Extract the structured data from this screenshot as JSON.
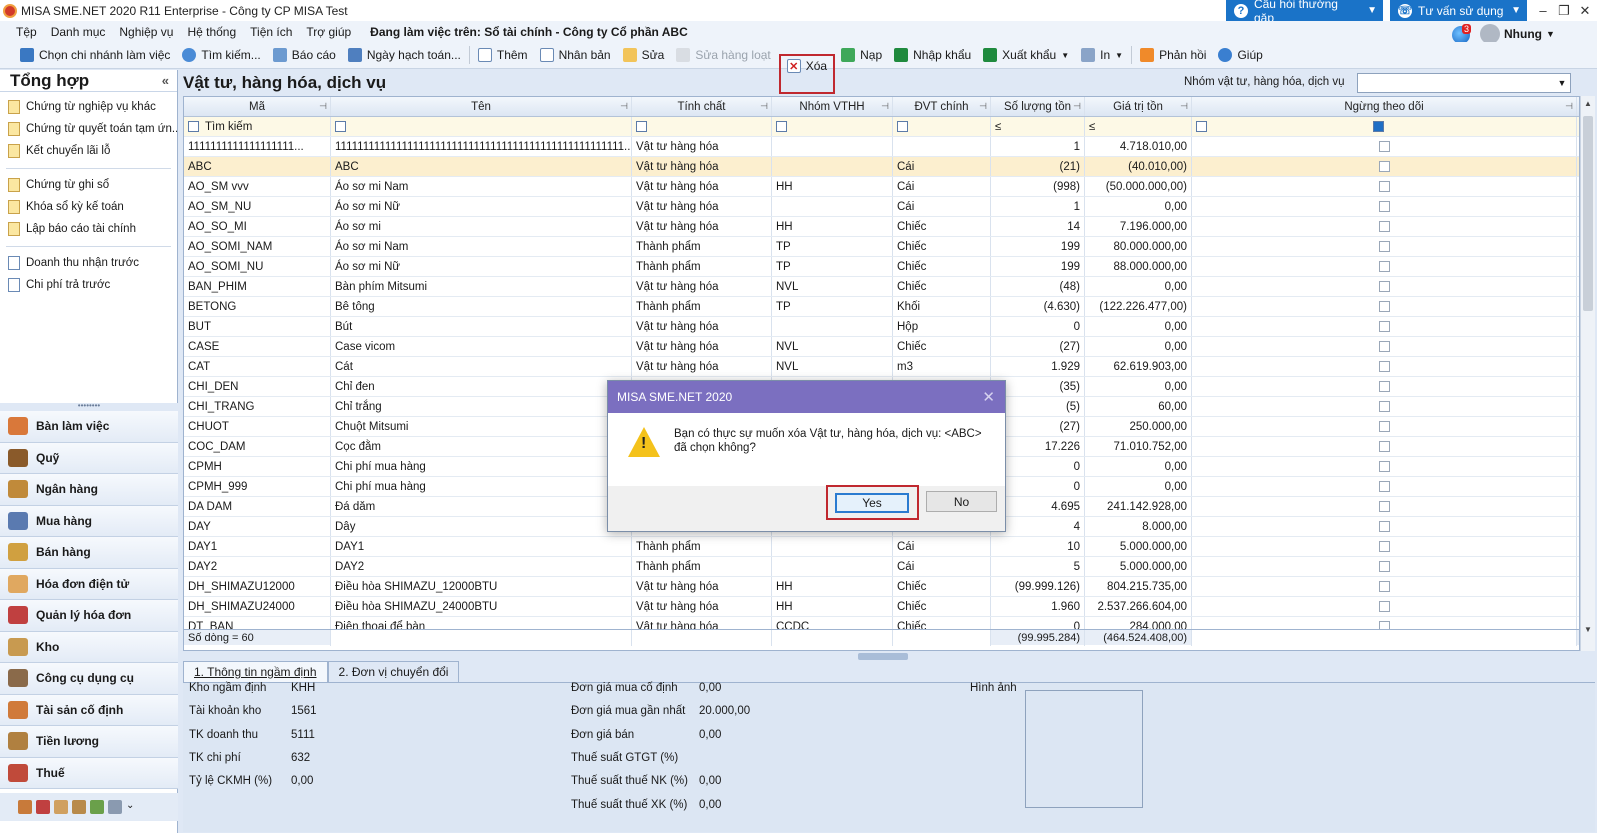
{
  "window": {
    "title": "MISA SME.NET 2020 R11 Enterprise - Công ty CP MISA Test",
    "help": "Câu hỏi thường gặp",
    "consult": "Tư vấn sử dụng"
  },
  "menu": {
    "items": [
      "Tệp",
      "Danh mục",
      "Nghiệp vụ",
      "Hệ thống",
      "Tiện ích",
      "Trợ giúp"
    ],
    "working": "Đang làm việc trên: Sổ tài chính - Công ty Cổ phần ABC"
  },
  "user": {
    "name": "Nhung",
    "notif_count": "3"
  },
  "toolbar": {
    "branch": "Chọn chi nhánh làm việc",
    "search": "Tìm kiếm...",
    "report": "Báo cáo",
    "date": "Ngày hạch toán...",
    "add": "Thêm",
    "copy": "Nhân bản",
    "edit": "Sửa",
    "bulk_edit": "Sửa hàng loạt",
    "delete": "Xóa",
    "load": "Nạp",
    "import": "Nhập khẩu",
    "export": "Xuất khẩu",
    "print": "In",
    "feedback": "Phản hồi",
    "help": "Giúp"
  },
  "sidebar": {
    "title": "Tổng hợp",
    "items": [
      "Chứng từ nghiệp vụ khác",
      "Chứng từ quyết toán tạm ứn...",
      "Kết chuyển lãi lỗ",
      "Chứng từ ghi sổ",
      "Khóa sổ kỳ kế toán",
      "Lập báo cáo tài chính",
      "Doanh thu nhận trước",
      "Chi phí trả trước"
    ],
    "modules": [
      "Bàn làm việc",
      "Quỹ",
      "Ngân hàng",
      "Mua hàng",
      "Bán hàng",
      "Hóa đơn điện tử",
      "Quản lý hóa đơn",
      "Kho",
      "Công cụ dụng cụ",
      "Tài sản cố định",
      "Tiền lương",
      "Thuế"
    ]
  },
  "main": {
    "title": "Vật tư, hàng hóa, dịch vụ",
    "group_label": "Nhóm vật tư, hàng hóa, dịch vụ",
    "group_value": ""
  },
  "grid": {
    "columns": [
      "Mã",
      "Tên",
      "Tính chất",
      "Nhóm VTHH",
      "ĐVT chính",
      "Số lượng tồn",
      "Giá trị tồn",
      "Ngừng theo dõi"
    ],
    "filter_search": "Tìm kiếm",
    "filter_le": "≤",
    "rows": [
      [
        "1111111111111111111...",
        "1111111111111111111111111111111111111111111111111111...",
        "Vật tư hàng hóa",
        "",
        "",
        "1",
        "4.718.010,00"
      ],
      [
        "ABC",
        "ABC",
        "Vật tư hàng hóa",
        "",
        "Cái",
        "(21)",
        "(40.010,00)"
      ],
      [
        "AO_SM vvv",
        "Áo sơ mi Nam",
        "Vật tư hàng hóa",
        "HH",
        "Cái",
        "(998)",
        "(50.000.000,00)"
      ],
      [
        "AO_SM_NU",
        "Áo sơ mi Nữ",
        "Vật tư hàng hóa",
        "",
        "Cái",
        "1",
        "0,00"
      ],
      [
        "AO_SO_MI",
        "Áo sơ mi",
        "Vật tư hàng hóa",
        "HH",
        "Chiếc",
        "14",
        "7.196.000,00"
      ],
      [
        "AO_SOMI_NAM",
        "Áo sơ mi Nam",
        "Thành phẩm",
        "TP",
        "Chiếc",
        "199",
        "80.000.000,00"
      ],
      [
        "AO_SOMI_NU",
        "Áo sơ mi Nữ",
        "Thành phẩm",
        "TP",
        "Chiếc",
        "199",
        "88.000.000,00"
      ],
      [
        "BAN_PHIM",
        "Bàn phím Mitsumi",
        "Vật tư hàng hóa",
        "NVL",
        "Chiếc",
        "(48)",
        "0,00"
      ],
      [
        "BETONG",
        "Bê tông",
        "Thành phẩm",
        "TP",
        "Khối",
        "(4.630)",
        "(122.226.477,00)"
      ],
      [
        "BUT",
        "Bút",
        "Vật tư hàng hóa",
        "",
        "Hộp",
        "0",
        "0,00"
      ],
      [
        "CASE",
        "Case vicom",
        "Vật tư hàng hóa",
        "NVL",
        "Chiếc",
        "(27)",
        "0,00"
      ],
      [
        "CAT",
        "Cát",
        "Vật tư hàng hóa",
        "NVL",
        "m3",
        "1.929",
        "62.619.903,00"
      ],
      [
        "CHI_DEN",
        "Chỉ đen",
        "",
        "",
        "",
        "(35)",
        "0,00"
      ],
      [
        "CHI_TRANG",
        "Chỉ trắng",
        "",
        "",
        "",
        "(5)",
        "60,00"
      ],
      [
        "CHUOT",
        "Chuột Mitsumi",
        "",
        "",
        "",
        "(27)",
        "250.000,00"
      ],
      [
        "COC_DAM",
        "Cọc đằm",
        "",
        "",
        "",
        "17.226",
        "71.010.752,00"
      ],
      [
        "CPMH",
        "Chi phí mua hàng",
        "",
        "",
        "",
        "0",
        "0,00"
      ],
      [
        "CPMH_999",
        "Chi phí mua hàng",
        "",
        "",
        "",
        "0",
        "0,00"
      ],
      [
        "DA DAM",
        "Đá dăm",
        "",
        "",
        "",
        "4.695",
        "241.142.928,00"
      ],
      [
        "DAY",
        "Dây",
        "",
        "",
        "",
        "4",
        "8.000,00"
      ],
      [
        "DAY1",
        "DAY1",
        "Thành phẩm",
        "",
        "Cái",
        "10",
        "5.000.000,00"
      ],
      [
        "DAY2",
        "DAY2",
        "Thành phẩm",
        "",
        "Cái",
        "5",
        "5.000.000,00"
      ],
      [
        "DH_SHIMAZU12000",
        "Điều hòa SHIMAZU_12000BTU",
        "Vật tư hàng hóa",
        "HH",
        "Chiếc",
        "(99.999.126)",
        "804.215.735,00"
      ],
      [
        "DH_SHIMAZU24000",
        "Điều hòa SHIMAZU_24000BTU",
        "Vật tư hàng hóa",
        "HH",
        "Chiếc",
        "1.960",
        "2.537.266.604,00"
      ],
      [
        "DT_BAN",
        "Điện thoại để bàn",
        "Vật tư hàng hóa",
        "CCDC",
        "Chiếc",
        "0",
        "284.000,00"
      ]
    ],
    "footer": {
      "count": "Số dòng = 60",
      "qty": "(99.995.284)",
      "value": "(464.524.408,00)"
    }
  },
  "tabs": [
    "1. Thông tin ngầm định",
    "2. Đơn vị chuyển đổi"
  ],
  "detail": {
    "left": [
      [
        "Kho ngầm định",
        "KHH"
      ],
      [
        "Tài khoản kho",
        "1561"
      ],
      [
        "TK doanh thu",
        "5111"
      ],
      [
        "TK chi phí",
        "632"
      ],
      [
        "Tỷ lệ CKMH (%)",
        "0,00"
      ]
    ],
    "mid": [
      [
        "Đơn giá mua cố định",
        "0,00"
      ],
      [
        "Đơn giá mua gần nhất",
        "20.000,00"
      ],
      [
        "Đơn giá bán",
        "0,00"
      ],
      [
        "Thuế suất GTGT (%)",
        ""
      ],
      [
        "Thuế suất thuế NK (%)",
        "0,00"
      ],
      [
        "Thuế suất thuế XK (%)",
        "0,00"
      ]
    ],
    "image_label": "Hình ảnh"
  },
  "dialog": {
    "title": "MISA SME.NET 2020",
    "message": "Bạn có thực sự muốn xóa Vật tư, hàng hóa, dịch vụ: <ABC> đã chọn không?",
    "yes": "Yes",
    "no": "No"
  }
}
